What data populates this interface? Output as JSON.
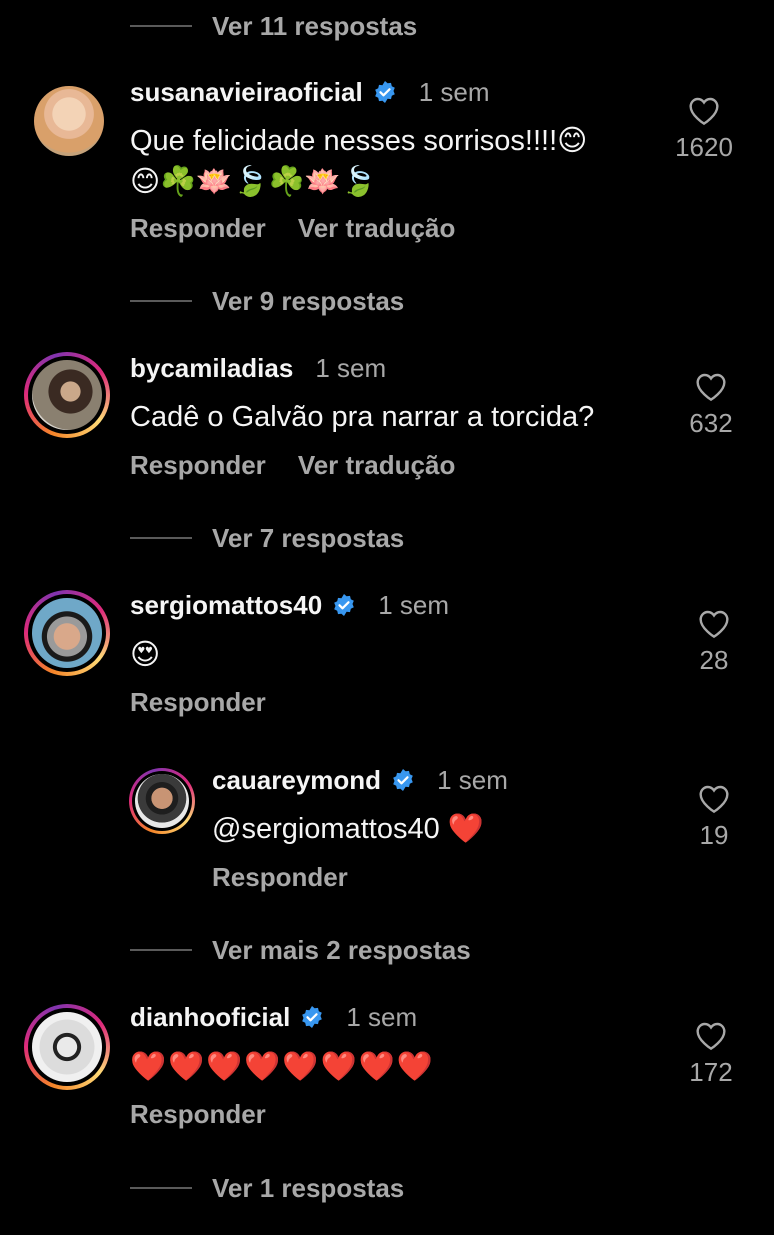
{
  "view_replies_1": "Ver 11 respostas",
  "view_replies_2": "Ver 9 respostas",
  "view_replies_3": "Ver 7 respostas",
  "view_replies_4": "Ver mais 2 respostas",
  "view_replies_5": "Ver 1 respostas",
  "reply_label": "Responder",
  "translate_label": "Ver tradução",
  "comments": [
    {
      "username": "susanavieiraoficial",
      "verified": true,
      "time": "1 sem",
      "text_line1": "Que felicidade nesses sorrisos!!!!😊",
      "text_line2": "😊☘️🪷🍃☘️🪷🍃",
      "likes": "1620"
    },
    {
      "username": "bycamiladias",
      "verified": false,
      "time": "1 sem",
      "text_line1": "Cadê o Galvão pra narrar a torcida?",
      "likes": "632"
    },
    {
      "username": "sergiomattos40",
      "verified": true,
      "time": "1 sem",
      "text_line1": "😍",
      "likes": "28"
    },
    {
      "username": "cauareymond",
      "verified": true,
      "time": "1 sem",
      "text_line1": "@sergiomattos40 ❤️",
      "likes": "19"
    },
    {
      "username": "dianhooficial",
      "verified": true,
      "time": "1 sem",
      "text_line1": "❤️❤️❤️❤️❤️❤️❤️❤️",
      "likes": "172"
    }
  ],
  "colors": {
    "background": "#000000",
    "text_primary": "#f5f5f5",
    "text_secondary": "#a8a8a8",
    "verified_blue": "#3897f0",
    "heart_red": "#e0245e"
  }
}
